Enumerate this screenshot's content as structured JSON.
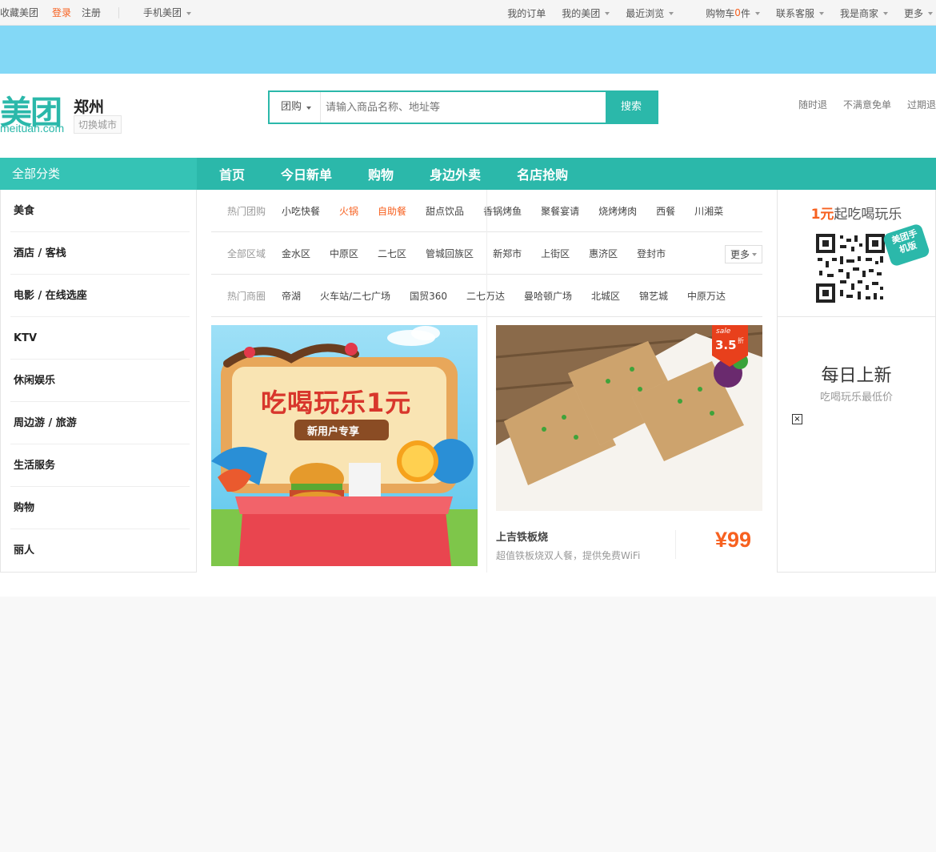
{
  "topbar": {
    "left": [
      "收藏美团",
      "登录",
      "注册",
      "手机美团"
    ],
    "right": [
      "我的订单",
      "我的美团",
      "最近浏览",
      "购物车",
      "0",
      "件",
      "联系客服",
      "我是商家",
      "更多"
    ]
  },
  "header": {
    "logo_cn": "美团",
    "logo_en": "meituan.com",
    "city": "郑州",
    "switch_city": "切换城市",
    "search_category": "团购",
    "search_placeholder": "请输入商品名称、地址等",
    "search_button": "搜索",
    "promises": [
      "随时退",
      "不满意免单",
      "过期退"
    ]
  },
  "nav": {
    "all_categories": "全部分类",
    "links": [
      "首页",
      "今日新单",
      "购物",
      "身边外卖",
      "名店抢购"
    ]
  },
  "sidebar": [
    "美食",
    "酒店 / 客栈",
    "电影 / 在线选座",
    "KTV",
    "休闲娱乐",
    "周边游 / 旅游",
    "生活服务",
    "购物",
    "丽人"
  ],
  "filters": {
    "hot_label": "热门团购",
    "hot": [
      "小吃快餐",
      "火锅",
      "自助餐",
      "甜点饮品",
      "香锅烤鱼",
      "聚餐宴请",
      "烧烤烤肉",
      "西餐",
      "川湘菜"
    ],
    "area_label": "全部区域",
    "areas": [
      "金水区",
      "中原区",
      "二七区",
      "管城回族区",
      "新郑市",
      "上街区",
      "惠济区",
      "登封市"
    ],
    "more": "更多",
    "biz_label": "热门商圈",
    "biz": [
      "帝湖",
      "火车站/二七广场",
      "国贸360",
      "二七万达",
      "曼哈顿广场",
      "北城区",
      "锦艺城",
      "中原万达"
    ]
  },
  "promo": {
    "headline": "吃喝玩乐1元",
    "sub": "新用户专享"
  },
  "deal": {
    "badge_sale": "sale",
    "badge_discount": "3.5",
    "badge_unit": "折",
    "title": "上吉铁板烧",
    "desc": "超值铁板烧双人餐，提供免费WiFi",
    "price": "¥99"
  },
  "right": {
    "tag_num": "1元",
    "tag_rest": "起吃喝玩乐",
    "qr_label": "美团手机版",
    "daily": "每日上新",
    "daily_sub": "吃喝玩乐最低价"
  }
}
